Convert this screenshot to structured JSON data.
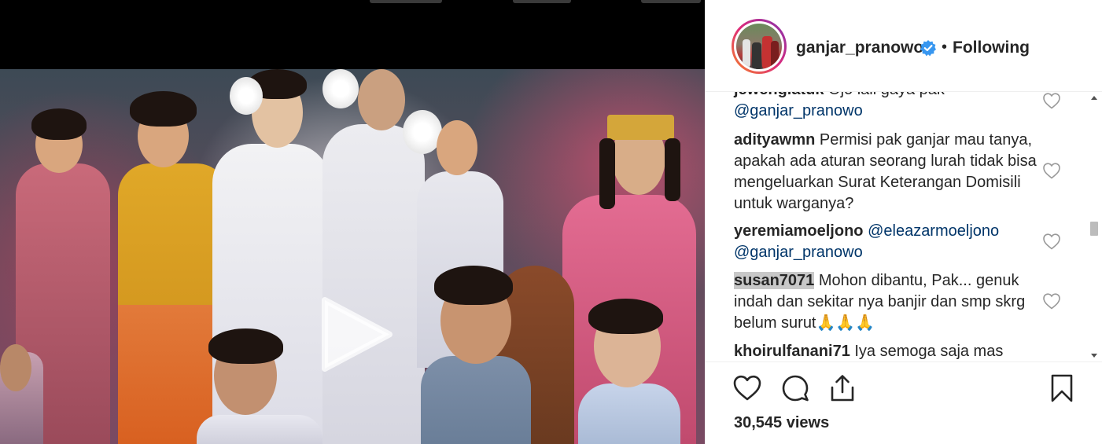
{
  "header": {
    "username": "ganjar_pranowo",
    "separator": "•",
    "follow_status": "Following"
  },
  "comments": [
    {
      "user": "jewengiatuk",
      "text": " Ojo lali gaya pak",
      "mention": "@ganjar_pranowo"
    },
    {
      "user": "adityawmn",
      "text": " Permisi pak ganjar mau tanya, apakah ada aturan seorang lurah tidak bisa mengeluarkan Surat Keterangan Domisili untuk warganya?"
    },
    {
      "user": "yeremiamoeljono",
      "mention1": " @eleazarmoeljono",
      "mention2": "@ganjar_pranowo"
    },
    {
      "user": "susan7071",
      "text": " Mohon dibantu, Pak... genuk indah dan sekitar nya banjir dan smp skrg belum surut🙏🙏🙏"
    },
    {
      "user": "khoirulfanani71",
      "text": " Iya semoga saja mas"
    }
  ],
  "actions": {
    "like": "heart-icon",
    "comment": "comment-icon",
    "share": "share-icon",
    "save": "bookmark-icon"
  },
  "views": "30,545 views",
  "colors": {
    "text": "#262626",
    "mention": "#003569",
    "verified": "#3897f0",
    "ring_start": "#f58529",
    "ring_end": "#8134af"
  }
}
